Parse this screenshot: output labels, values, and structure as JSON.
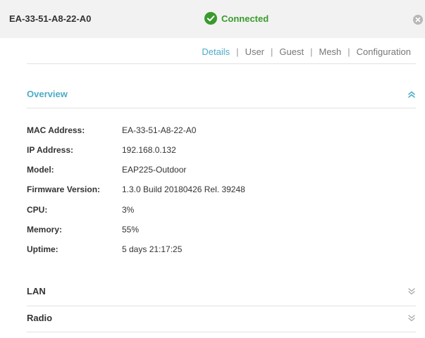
{
  "header": {
    "device_name": "EA-33-51-A8-22-A0",
    "status_text": "Connected",
    "status_color": "#3a9a2e"
  },
  "tabs": [
    {
      "label": "Details",
      "active": true
    },
    {
      "label": "User",
      "active": false
    },
    {
      "label": "Guest",
      "active": false
    },
    {
      "label": "Mesh",
      "active": false
    },
    {
      "label": "Configuration",
      "active": false
    }
  ],
  "tab_separator": "|",
  "overview": {
    "title": "Overview",
    "expanded": true,
    "rows": [
      {
        "label": "MAC Address:",
        "value": "EA-33-51-A8-22-A0"
      },
      {
        "label": "IP Address:",
        "value": "192.168.0.132"
      },
      {
        "label": "Model:",
        "value": "EAP225-Outdoor"
      },
      {
        "label": "Firmware Version:",
        "value": "1.3.0 Build 20180426 Rel. 39248"
      },
      {
        "label": "CPU:",
        "value": "3%"
      },
      {
        "label": "Memory:",
        "value": "55%"
      },
      {
        "label": "Uptime:",
        "value": "5 days 21:17:25"
      }
    ]
  },
  "lan": {
    "title": "LAN",
    "expanded": false
  },
  "radio": {
    "title": "Radio",
    "expanded": false
  },
  "colors": {
    "accent": "#4dabc8",
    "header_bg": "#f2f2f2",
    "divider": "#e2e2e2"
  },
  "icons": {
    "status": "check-circle-icon",
    "close": "close-circle-icon",
    "collapse": "double-chevron-up-icon",
    "expand": "double-chevron-down-icon"
  }
}
